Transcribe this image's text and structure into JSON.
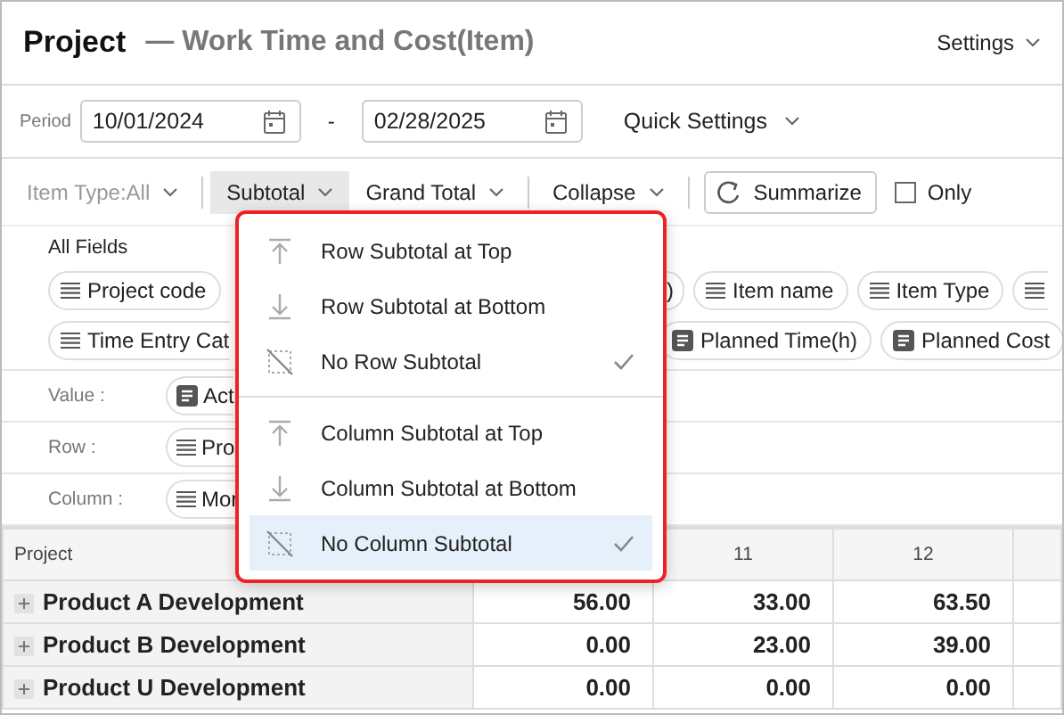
{
  "header": {
    "title": "Project",
    "subtitle": "— Work Time and Cost(Item)",
    "settings": "Settings"
  },
  "period": {
    "label": "Period",
    "start": "10/01/2024",
    "separator": "-",
    "end": "02/28/2025",
    "quick_settings": "Quick Settings"
  },
  "toolbar": [
    {
      "kind": "dropdown",
      "label": "Item Type:All",
      "disabled": true,
      "selected": false
    },
    {
      "kind": "divider"
    },
    {
      "kind": "dropdown",
      "label": "Subtotal",
      "disabled": false,
      "selected": true
    },
    {
      "kind": "dropdown",
      "label": "Grand Total",
      "disabled": false,
      "selected": false
    },
    {
      "kind": "divider"
    },
    {
      "kind": "dropdown",
      "label": "Collapse",
      "disabled": false,
      "selected": false
    },
    {
      "kind": "divider"
    },
    {
      "kind": "button",
      "label": "Summarize"
    },
    {
      "kind": "checkbox",
      "label": "Only",
      "checked": false
    }
  ],
  "all_fields": {
    "label": "All Fields",
    "row_1_left": [
      {
        "label": "Project code",
        "kind": "dimension"
      }
    ],
    "row_1_right": [
      {
        "label": ")",
        "kind": "fragment"
      },
      {
        "label": "Item name",
        "kind": "dimension"
      },
      {
        "label": "Item Type",
        "kind": "dimension"
      },
      {
        "kind": "edge"
      }
    ],
    "row_2_left": [
      {
        "label": "Time Entry Cat",
        "kind": "cut"
      }
    ],
    "row_2_right": [
      {
        "label": "Planned Time(h)",
        "kind": "value"
      },
      {
        "label": "Planned Cost",
        "kind": "value"
      }
    ]
  },
  "areas": [
    {
      "label": "Value :",
      "chip": "Act",
      "kind": "value"
    },
    {
      "label": "Row :",
      "chip": "Pro",
      "kind": "dimension"
    },
    {
      "label": "Column :",
      "chip": "Mor",
      "kind": "dimension"
    }
  ],
  "table": {
    "columns": [
      "Project",
      "11",
      "12"
    ],
    "rows": [
      {
        "name": "Product A Development",
        "values": [
          "56.00",
          "33.00",
          "63.50"
        ]
      },
      {
        "name": "Product B Development",
        "values": [
          "0.00",
          "23.00",
          "39.00"
        ]
      },
      {
        "name": "Product U Development",
        "values": [
          "0.00",
          "0.00",
          "0.00"
        ]
      }
    ]
  },
  "menu": {
    "groups": [
      [
        {
          "label": "Row Subtotal at Top",
          "checked": false,
          "selected": false
        },
        {
          "label": "Row Subtotal at Bottom",
          "checked": false,
          "selected": false
        },
        {
          "label": "No Row Subtotal",
          "checked": true,
          "selected": false
        }
      ],
      [
        {
          "label": "Column Subtotal at Top",
          "checked": false,
          "selected": false
        },
        {
          "label": "Column Subtotal at Bottom",
          "checked": false,
          "selected": false
        },
        {
          "label": "No Column Subtotal",
          "checked": true,
          "selected": true
        }
      ]
    ]
  }
}
